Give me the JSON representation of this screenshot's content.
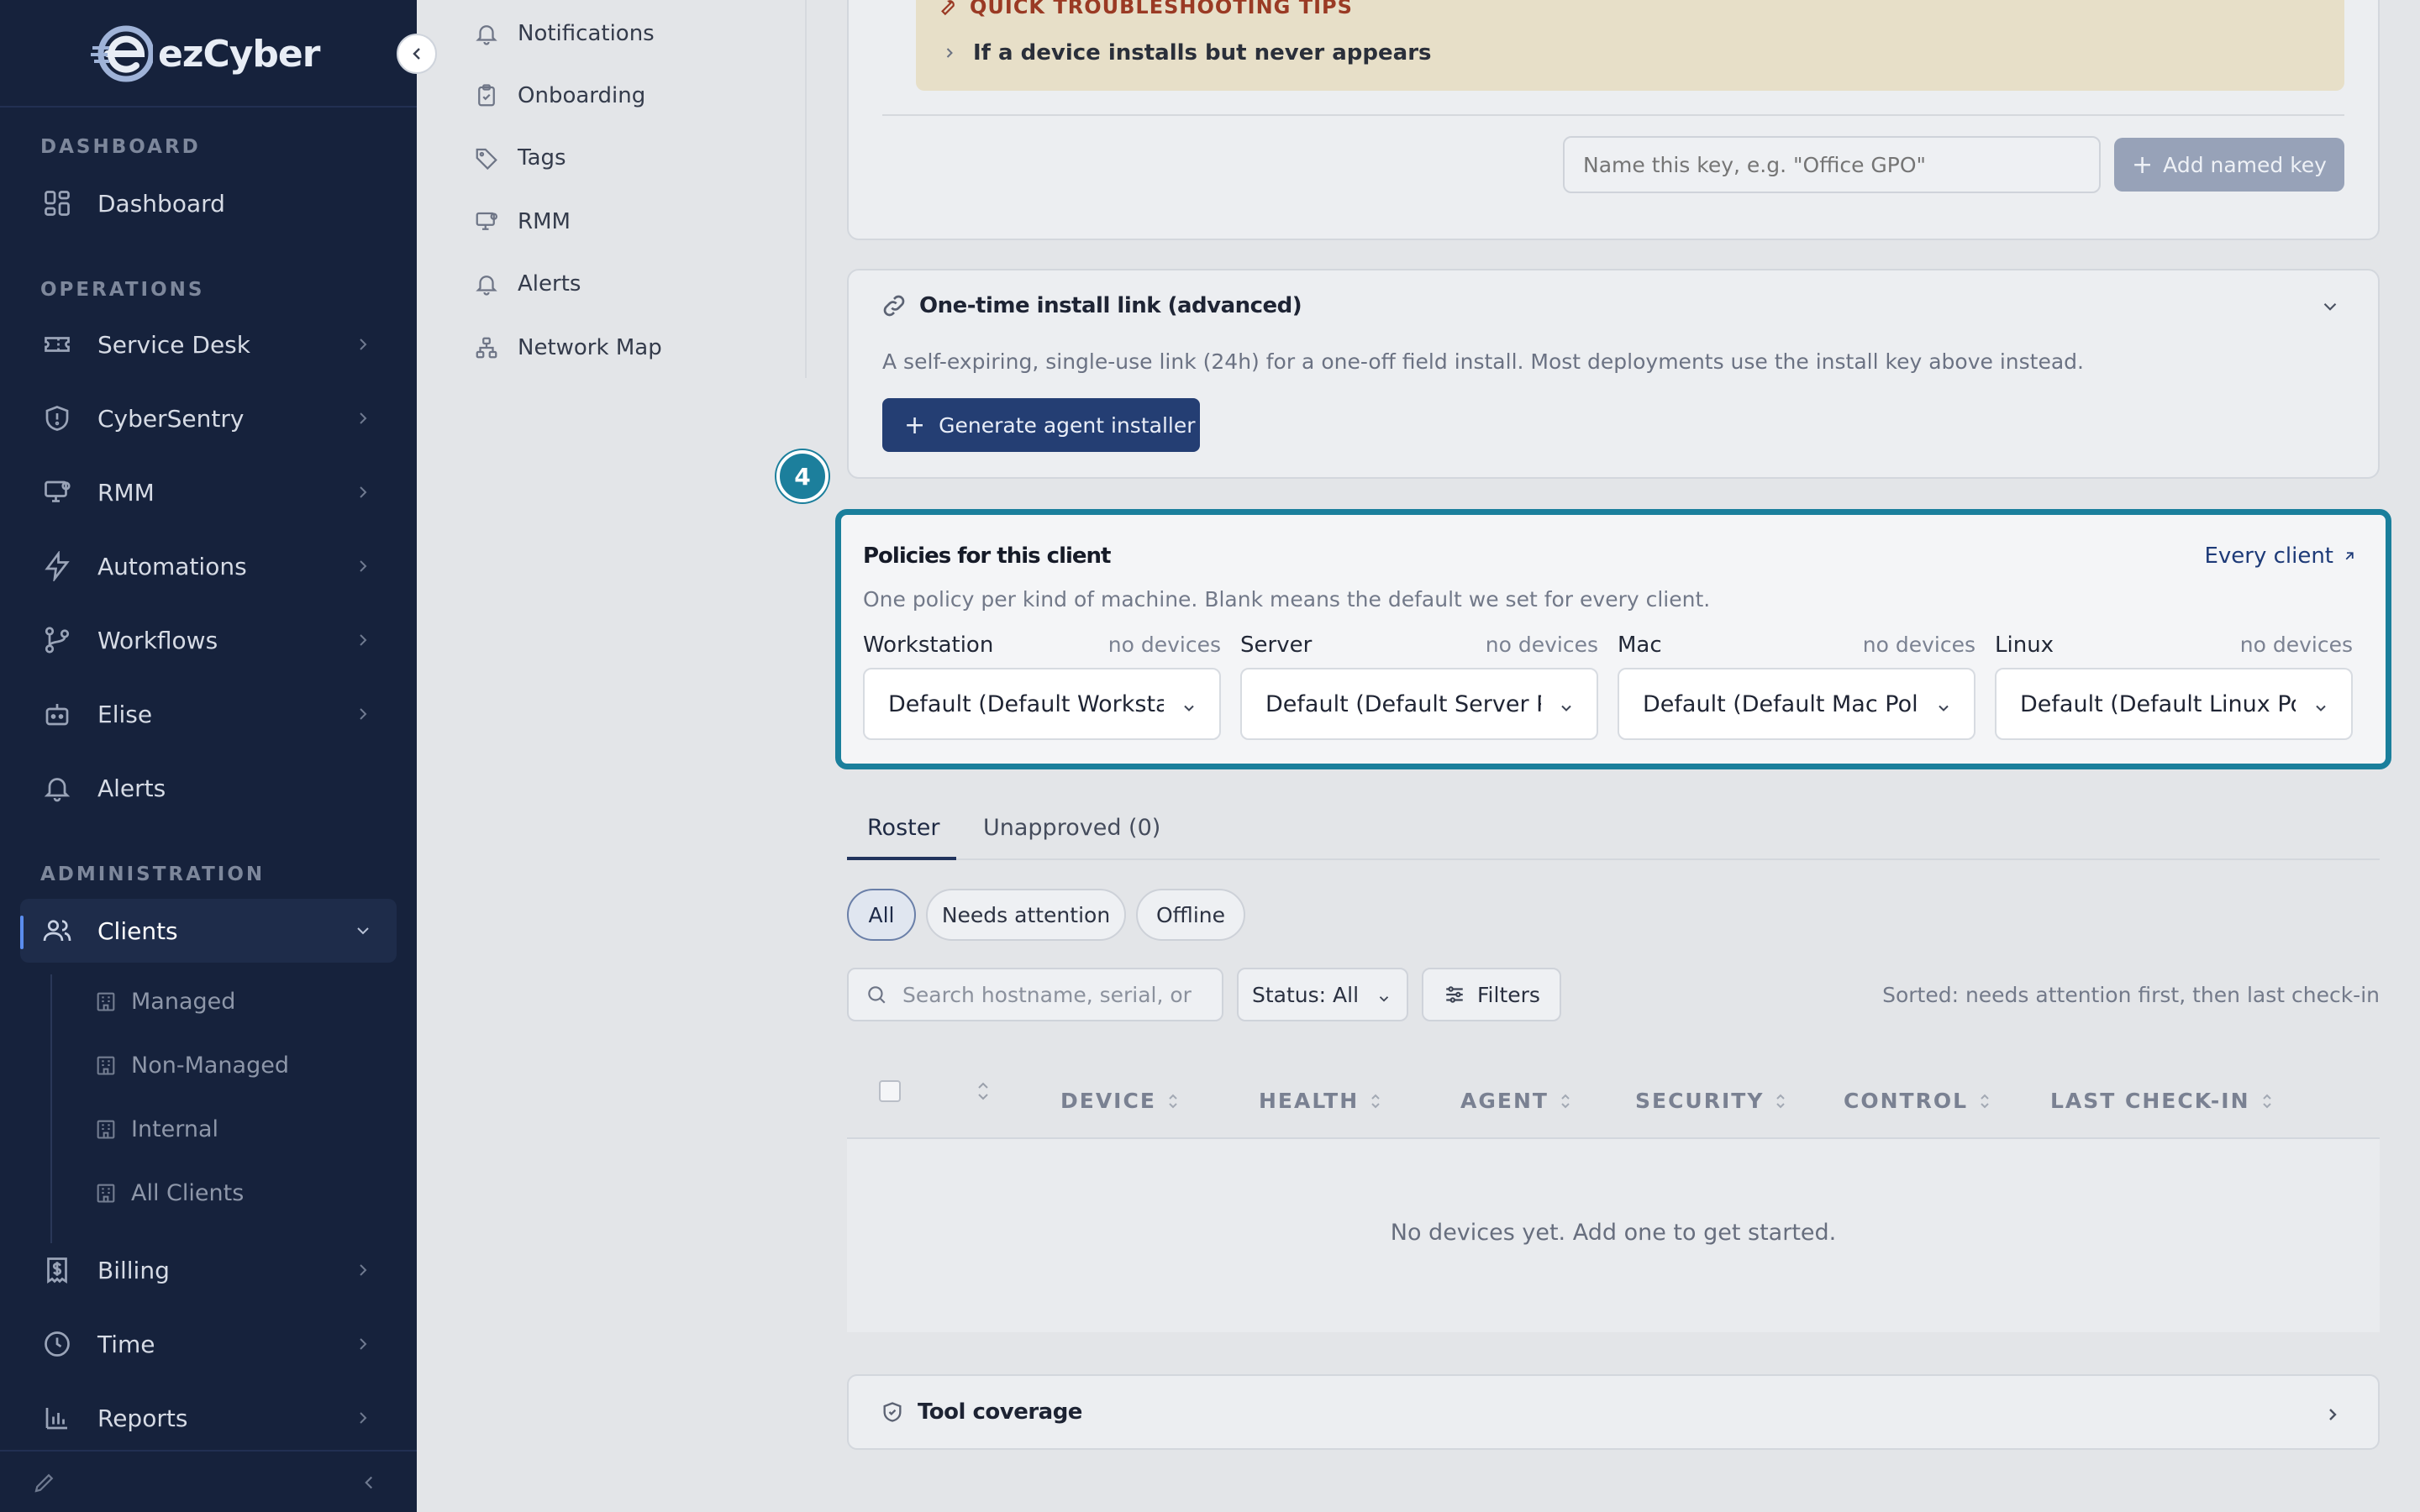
{
  "app": {
    "brand": "ezCyber"
  },
  "sidebar": {
    "sections": {
      "dashboard": "DASHBOARD",
      "operations": "OPERATIONS",
      "administration": "ADMINISTRATION"
    },
    "items": {
      "dashboard": "Dashboard",
      "service_desk": "Service Desk",
      "cybersentry": "CyberSentry",
      "rmm": "RMM",
      "automations": "Automations",
      "workflows": "Workflows",
      "elise": "Elise",
      "alerts": "Alerts",
      "clients": "Clients",
      "billing": "Billing",
      "time": "Time",
      "reports": "Reports"
    },
    "clients_sub": [
      "Managed",
      "Non-Managed",
      "Internal",
      "All Clients"
    ]
  },
  "subnav": [
    "Notifications",
    "Onboarding",
    "Tags",
    "RMM",
    "Alerts",
    "Network Map"
  ],
  "tips": {
    "title": "QUICK TROUBLESHOOTING TIPS",
    "row": "If a device installs but never appears"
  },
  "named_key": {
    "placeholder": "Name this key, e.g. \"Office GPO\"",
    "button": "Add named key"
  },
  "install_link": {
    "title": "One-time install link (advanced)",
    "description": "A self-expiring, single-use link (24h) for a one-off field install. Most deployments use the install key above instead.",
    "button": "Generate agent installer"
  },
  "step_badge": "4",
  "policies": {
    "title": "Policies for this client",
    "description": "One policy per kind of machine. Blank means the default we set for every client.",
    "link": "Every client",
    "columns": [
      {
        "kind": "Workstation",
        "count": "no devices",
        "value": "Default (Default Workstation Policy)"
      },
      {
        "kind": "Server",
        "count": "no devices",
        "value": "Default (Default Server Policy)"
      },
      {
        "kind": "Mac",
        "count": "no devices",
        "value": "Default (Default Mac Policy)"
      },
      {
        "kind": "Linux",
        "count": "no devices",
        "value": "Default (Default Linux Policy)"
      }
    ]
  },
  "tabs": {
    "roster": "Roster",
    "unapproved": "Unapproved (0)"
  },
  "pills": {
    "all": "All",
    "needs_attention": "Needs attention",
    "offline": "Offline"
  },
  "search": {
    "placeholder": "Search hostname, serial, or"
  },
  "status_select": "Status: All",
  "filters": "Filters",
  "sorted_note": "Sorted: needs attention first, then last check-in",
  "table": {
    "columns": [
      "DEVICE",
      "HEALTH",
      "AGENT",
      "SECURITY",
      "CONTROL",
      "LAST CHECK-IN"
    ],
    "empty": "No devices yet. Add one to get started."
  },
  "tool_coverage": "Tool coverage",
  "colors": {
    "sidebar_bg": "#16223c",
    "accent": "#1a7f9c",
    "primary_button": "#243e73"
  }
}
